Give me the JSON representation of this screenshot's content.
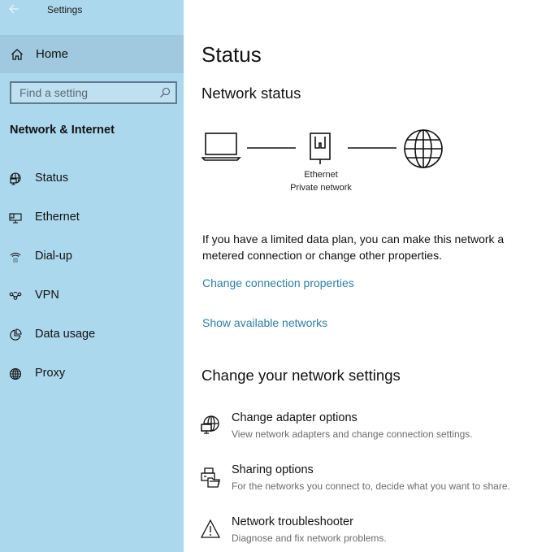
{
  "window": {
    "title": "Settings"
  },
  "sidebar": {
    "home_label": "Home",
    "search": {
      "placeholder": "Find a setting",
      "value": ""
    },
    "section_title": "Network & Internet",
    "items": [
      {
        "label": "Status",
        "icon": "status-globe-icon"
      },
      {
        "label": "Ethernet",
        "icon": "ethernet-icon"
      },
      {
        "label": "Dial-up",
        "icon": "dialup-phone-icon"
      },
      {
        "label": "VPN",
        "icon": "vpn-icon"
      },
      {
        "label": "Data usage",
        "icon": "pie-chart-icon"
      },
      {
        "label": "Proxy",
        "icon": "globe-icon"
      }
    ]
  },
  "main": {
    "page_title": "Status",
    "network_status": {
      "heading": "Network status",
      "connection_name": "Ethernet",
      "connection_type": "Private network"
    },
    "metered_text": "If you have a limited data plan, you can make this network a metered connection or change other properties.",
    "links": {
      "change_connection_properties": "Change connection properties",
      "show_available_networks": "Show available networks"
    },
    "change_settings": {
      "heading": "Change your network settings",
      "items": [
        {
          "title": "Change adapter options",
          "description": "View network adapters and change connection settings.",
          "icon": "adapter-globe-icon"
        },
        {
          "title": "Sharing options",
          "description": "For the networks you connect to, decide what you want to share.",
          "icon": "sharing-printer-folder-icon"
        },
        {
          "title": "Network troubleshooter",
          "description": "Diagnose and fix network problems.",
          "icon": "warning-triangle-icon"
        }
      ]
    }
  }
}
